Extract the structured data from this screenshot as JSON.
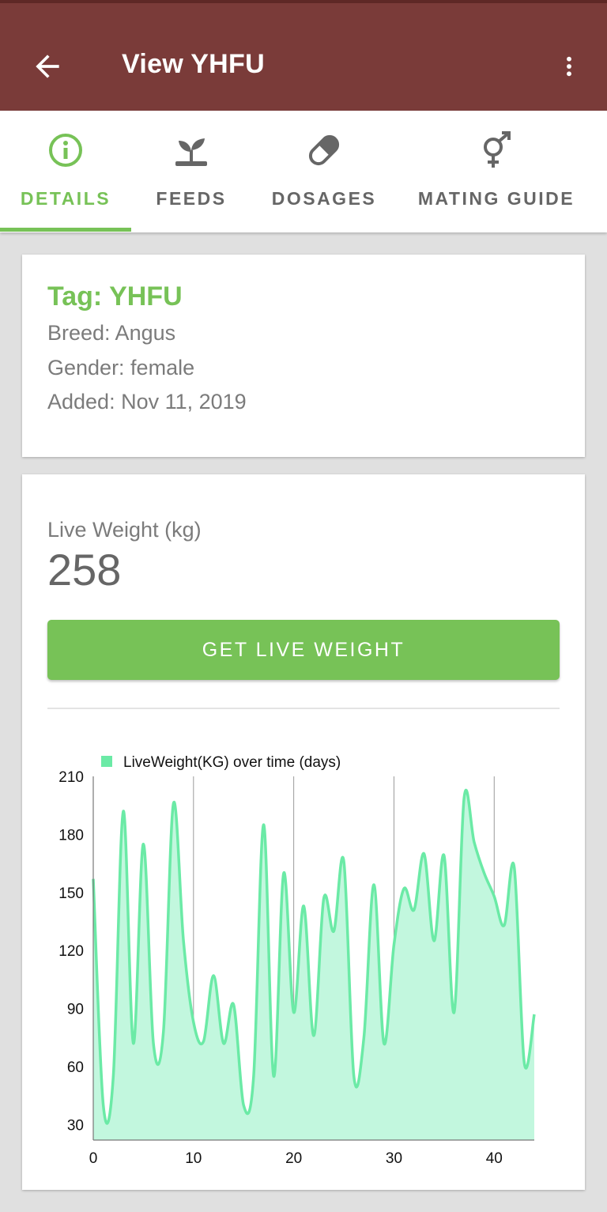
{
  "appbar": {
    "title": "View YHFU",
    "back_icon": "arrow-back-icon",
    "menu_icon": "more-vert-icon",
    "color": "#7a3b39"
  },
  "tabs": [
    {
      "label": "DETAILS",
      "icon": "info-icon",
      "active": true
    },
    {
      "label": "FEEDS",
      "icon": "sprout-icon",
      "active": false
    },
    {
      "label": "DOSAGES",
      "icon": "pill-icon",
      "active": false
    },
    {
      "label": "MATING GUIDE",
      "icon": "gender-icon",
      "active": false
    }
  ],
  "animal": {
    "tag": "Tag: YHFU",
    "breed": "Breed: Angus",
    "gender": "Gender: female",
    "added": "Added: Nov 11, 2019"
  },
  "live_weight": {
    "label": "Live Weight (kg)",
    "value": "258",
    "button_label": "GET LIVE WEIGHT"
  },
  "accent_color": "#77c257",
  "chart_data": {
    "type": "area",
    "legend": "LiveWeight(KG) over time (days)",
    "series_color": "#6beaa6",
    "x": [
      0,
      1,
      2,
      3,
      4,
      5,
      6,
      7,
      8,
      9,
      10,
      11,
      12,
      13,
      14,
      15,
      16,
      17,
      18,
      19,
      20,
      21,
      22,
      23,
      24,
      25,
      26,
      27,
      28,
      29,
      30,
      31,
      32,
      33,
      34,
      35,
      36,
      37,
      38,
      39,
      40,
      41,
      42,
      43,
      44
    ],
    "values": [
      157,
      40,
      55,
      192,
      72,
      175,
      72,
      78,
      196,
      125,
      83,
      73,
      107,
      72,
      92,
      40,
      55,
      185,
      55,
      160,
      88,
      143,
      76,
      147,
      130,
      166,
      55,
      75,
      154,
      72,
      123,
      152,
      141,
      170,
      125,
      169,
      88,
      199,
      176,
      160,
      148,
      133,
      163,
      62,
      87
    ],
    "xlim": [
      0,
      44
    ],
    "ylim": [
      22,
      210
    ],
    "x_ticks": [
      0,
      10,
      20,
      30,
      40
    ],
    "y_ticks": [
      30,
      60,
      90,
      120,
      150,
      180,
      210
    ],
    "vertical_grid": true
  }
}
